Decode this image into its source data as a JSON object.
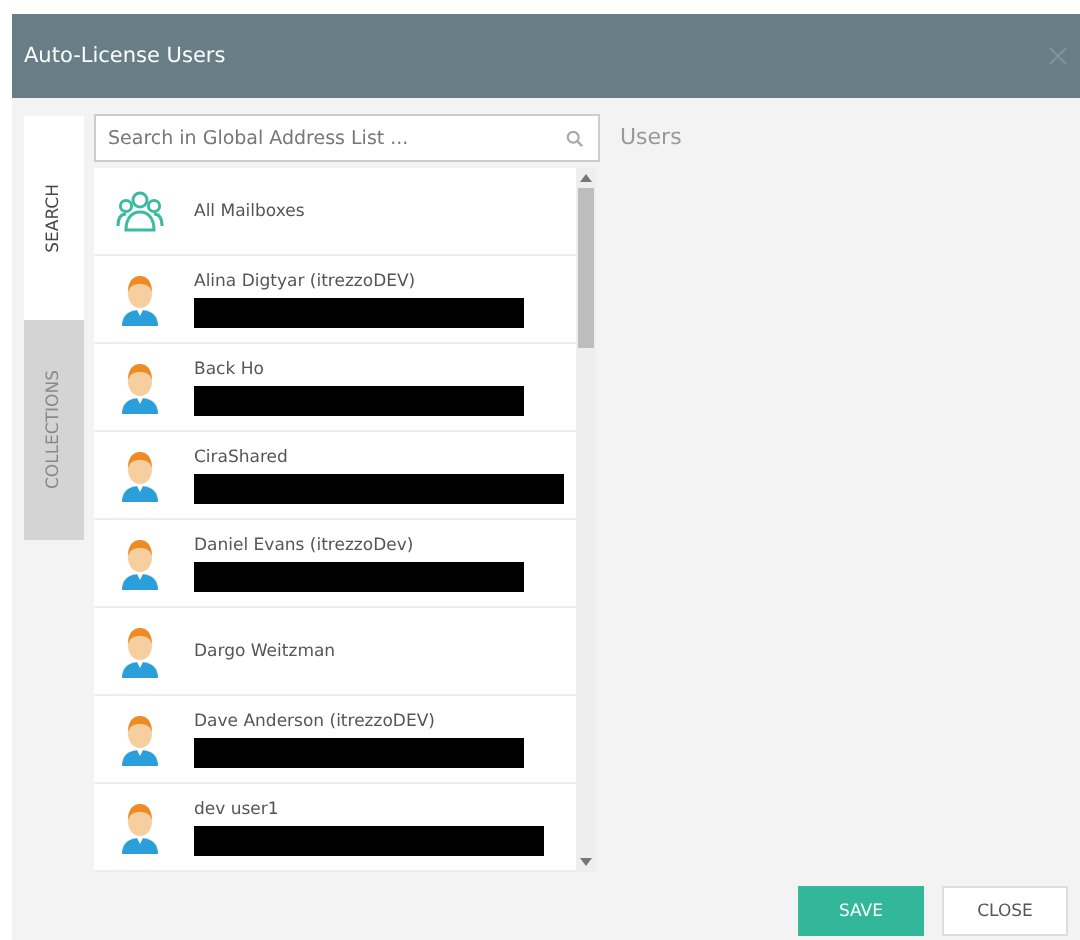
{
  "window": {
    "title": "Auto-License Users"
  },
  "side_tabs": [
    {
      "label": "SEARCH",
      "selected": true
    },
    {
      "label": "COLLECTIONS",
      "selected": false
    }
  ],
  "search": {
    "placeholder": "Search in Global Address List ..."
  },
  "target_label": "Users",
  "items": [
    {
      "kind": "group",
      "name": "All Mailboxes",
      "redacted": false
    },
    {
      "kind": "user",
      "name": "Alina Digtyar (itrezzoDEV)",
      "redacted": true
    },
    {
      "kind": "user",
      "name": "Back Ho",
      "redacted": true
    },
    {
      "kind": "user",
      "name": "CiraShared",
      "redacted": true
    },
    {
      "kind": "user",
      "name": "Daniel Evans (itrezzoDev)",
      "redacted": true
    },
    {
      "kind": "user",
      "name": "Dargo Weitzman",
      "redacted": false
    },
    {
      "kind": "user",
      "name": "Dave Anderson (itrezzoDEV)",
      "redacted": true
    },
    {
      "kind": "user",
      "name": "dev user1",
      "redacted": true
    }
  ],
  "buttons": [
    {
      "kind": "primary",
      "label": "SAVE"
    },
    {
      "kind": "secondary",
      "label": "CLOSE"
    }
  ]
}
